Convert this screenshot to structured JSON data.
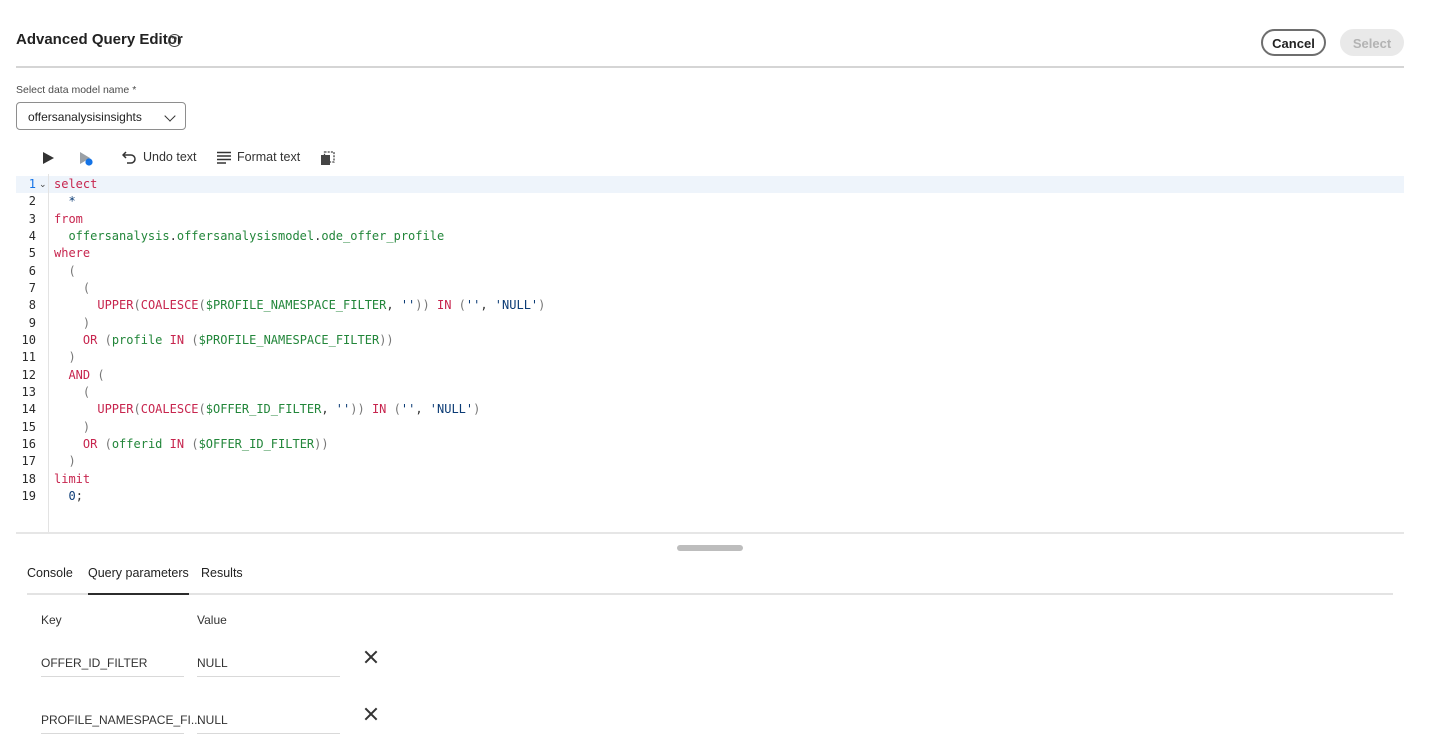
{
  "header": {
    "title": "Advanced Query Editor",
    "help_icon": "help-circle-icon",
    "cancel_label": "Cancel",
    "select_label": "Select"
  },
  "model_field": {
    "label": "Select data model name",
    "required_marker": "*",
    "value": "offersanalysisinsights",
    "chevron_icon": "chevron-down-icon"
  },
  "toolbar": {
    "run_icon": "play-icon",
    "run_selected_icon": "run-selected-icon",
    "undo_label": "Undo text",
    "format_label": "Format text",
    "copy_icon": "copy-icon"
  },
  "editor": {
    "line_numbers": [
      "1",
      "2",
      "3",
      "4",
      "5",
      "6",
      "7",
      "8",
      "9",
      "10",
      "11",
      "12",
      "13",
      "14",
      "15",
      "16",
      "17",
      "18",
      "19"
    ],
    "active_line": "1",
    "lines": [
      [
        [
          "kw",
          "select"
        ]
      ],
      [
        [
          "pl",
          "  "
        ],
        [
          "op",
          "*"
        ]
      ],
      [
        [
          "kw",
          "from"
        ]
      ],
      [
        [
          "pl",
          "  "
        ],
        [
          "id",
          "offersanalysis"
        ],
        [
          "pl",
          "."
        ],
        [
          "id",
          "offersanalysismodel"
        ],
        [
          "pl",
          "."
        ],
        [
          "id",
          "ode_offer_profile"
        ]
      ],
      [
        [
          "kw",
          "where"
        ]
      ],
      [
        [
          "pn",
          "  ("
        ]
      ],
      [
        [
          "pn",
          "    ("
        ]
      ],
      [
        [
          "pl",
          "      "
        ],
        [
          "fn",
          "UPPER"
        ],
        [
          "pn",
          "("
        ],
        [
          "fn",
          "COALESCE"
        ],
        [
          "pn",
          "("
        ],
        [
          "id",
          "$PROFILE_NAMESPACE_FILTER"
        ],
        [
          "pl",
          ", "
        ],
        [
          "str",
          "''"
        ],
        [
          "pn",
          "))"
        ],
        [
          "pl",
          " "
        ],
        [
          "kw",
          "IN"
        ],
        [
          "pl",
          " "
        ],
        [
          "pn",
          "("
        ],
        [
          "str",
          "''"
        ],
        [
          "pl",
          ", "
        ],
        [
          "str",
          "'NULL'"
        ],
        [
          "pn",
          ")"
        ]
      ],
      [
        [
          "pn",
          "    )"
        ]
      ],
      [
        [
          "pl",
          "    "
        ],
        [
          "kw",
          "OR"
        ],
        [
          "pl",
          " "
        ],
        [
          "pn",
          "("
        ],
        [
          "id",
          "profile"
        ],
        [
          "pl",
          " "
        ],
        [
          "kw",
          "IN"
        ],
        [
          "pl",
          " "
        ],
        [
          "pn",
          "("
        ],
        [
          "id",
          "$PROFILE_NAMESPACE_FILTER"
        ],
        [
          "pn",
          "))"
        ]
      ],
      [
        [
          "pn",
          "  )"
        ]
      ],
      [
        [
          "pl",
          "  "
        ],
        [
          "kw",
          "AND"
        ],
        [
          "pl",
          " "
        ],
        [
          "pn",
          "("
        ]
      ],
      [
        [
          "pn",
          "    ("
        ]
      ],
      [
        [
          "pl",
          "      "
        ],
        [
          "fn",
          "UPPER"
        ],
        [
          "pn",
          "("
        ],
        [
          "fn",
          "COALESCE"
        ],
        [
          "pn",
          "("
        ],
        [
          "id",
          "$OFFER_ID_FILTER"
        ],
        [
          "pl",
          ", "
        ],
        [
          "str",
          "''"
        ],
        [
          "pn",
          "))"
        ],
        [
          "pl",
          " "
        ],
        [
          "kw",
          "IN"
        ],
        [
          "pl",
          " "
        ],
        [
          "pn",
          "("
        ],
        [
          "str",
          "''"
        ],
        [
          "pl",
          ", "
        ],
        [
          "str",
          "'NULL'"
        ],
        [
          "pn",
          ")"
        ]
      ],
      [
        [
          "pn",
          "    )"
        ]
      ],
      [
        [
          "pl",
          "    "
        ],
        [
          "kw",
          "OR"
        ],
        [
          "pl",
          " "
        ],
        [
          "pn",
          "("
        ],
        [
          "id",
          "offerid"
        ],
        [
          "pl",
          " "
        ],
        [
          "kw",
          "IN"
        ],
        [
          "pl",
          " "
        ],
        [
          "pn",
          "("
        ],
        [
          "id",
          "$OFFER_ID_FILTER"
        ],
        [
          "pn",
          "))"
        ]
      ],
      [
        [
          "pn",
          "  )"
        ]
      ],
      [
        [
          "kw",
          "limit"
        ]
      ],
      [
        [
          "pl",
          "  "
        ],
        [
          "num",
          "0"
        ],
        [
          "pl",
          ";"
        ]
      ]
    ]
  },
  "tabs": [
    {
      "label": "Console"
    },
    {
      "label": "Query parameters",
      "active": true
    },
    {
      "label": "Results"
    }
  ],
  "params": {
    "key_header": "Key",
    "value_header": "Value",
    "rows": [
      {
        "key": "OFFER_ID_FILTER",
        "value": "NULL",
        "delete_icon": "close-icon"
      },
      {
        "key": "PROFILE_NAMESPACE_FI...",
        "value": "NULL",
        "delete_icon": "close-icon"
      }
    ]
  }
}
